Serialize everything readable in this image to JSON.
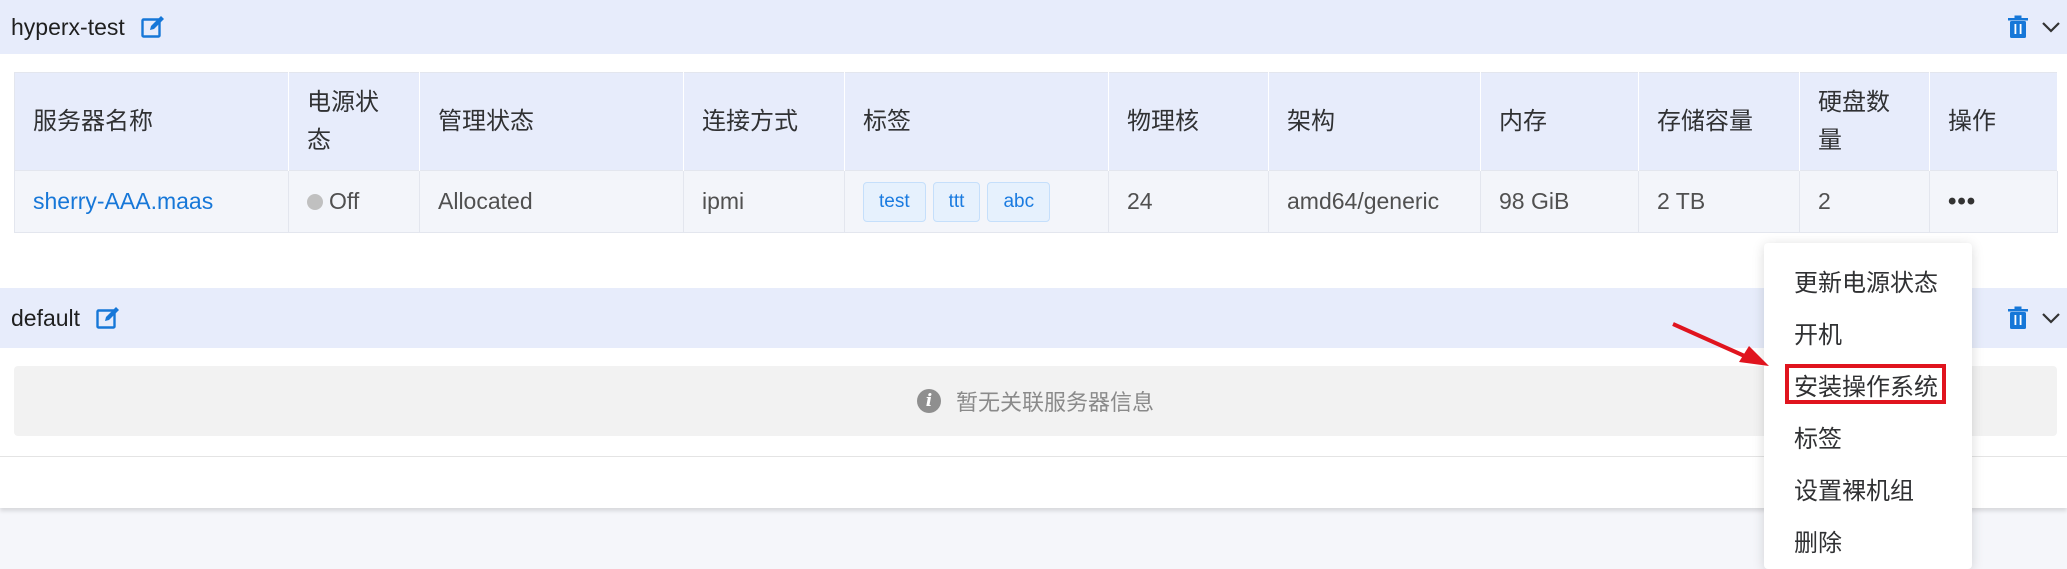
{
  "groups": [
    {
      "name": "hyperx-test",
      "table": {
        "headers": [
          "服务器名称",
          "电源状态",
          "管理状态",
          "连接方式",
          "标签",
          "物理核",
          "架构",
          "内存",
          "存储容量",
          "硬盘数量",
          "操作"
        ],
        "rows": [
          {
            "name": "sherry-AAA.maas",
            "power": "Off",
            "status": "Allocated",
            "connection": "ipmi",
            "tags": [
              "test",
              "ttt",
              "abc"
            ],
            "cores": "24",
            "arch": "amd64/generic",
            "memory": "98 GiB",
            "storage": "2 TB",
            "disks": "2",
            "actions_icon": "more-icon"
          }
        ]
      }
    },
    {
      "name": "default",
      "empty_message": "暂无关联服务器信息"
    }
  ],
  "dropdown": {
    "items": [
      "更新电源状态",
      "开机",
      "安装操作系统",
      "标签",
      "设置裸机组",
      "删除"
    ],
    "highlighted": "安装操作系统"
  },
  "colors": {
    "accent": "#1677d8",
    "header_bg": "#e7ecfb",
    "highlight": "#e0141e"
  },
  "icons": [
    "edit-icon",
    "trash-icon",
    "chevron-down-icon",
    "info-icon",
    "more-icon",
    "power-status-dot",
    "annotation-arrow"
  ]
}
